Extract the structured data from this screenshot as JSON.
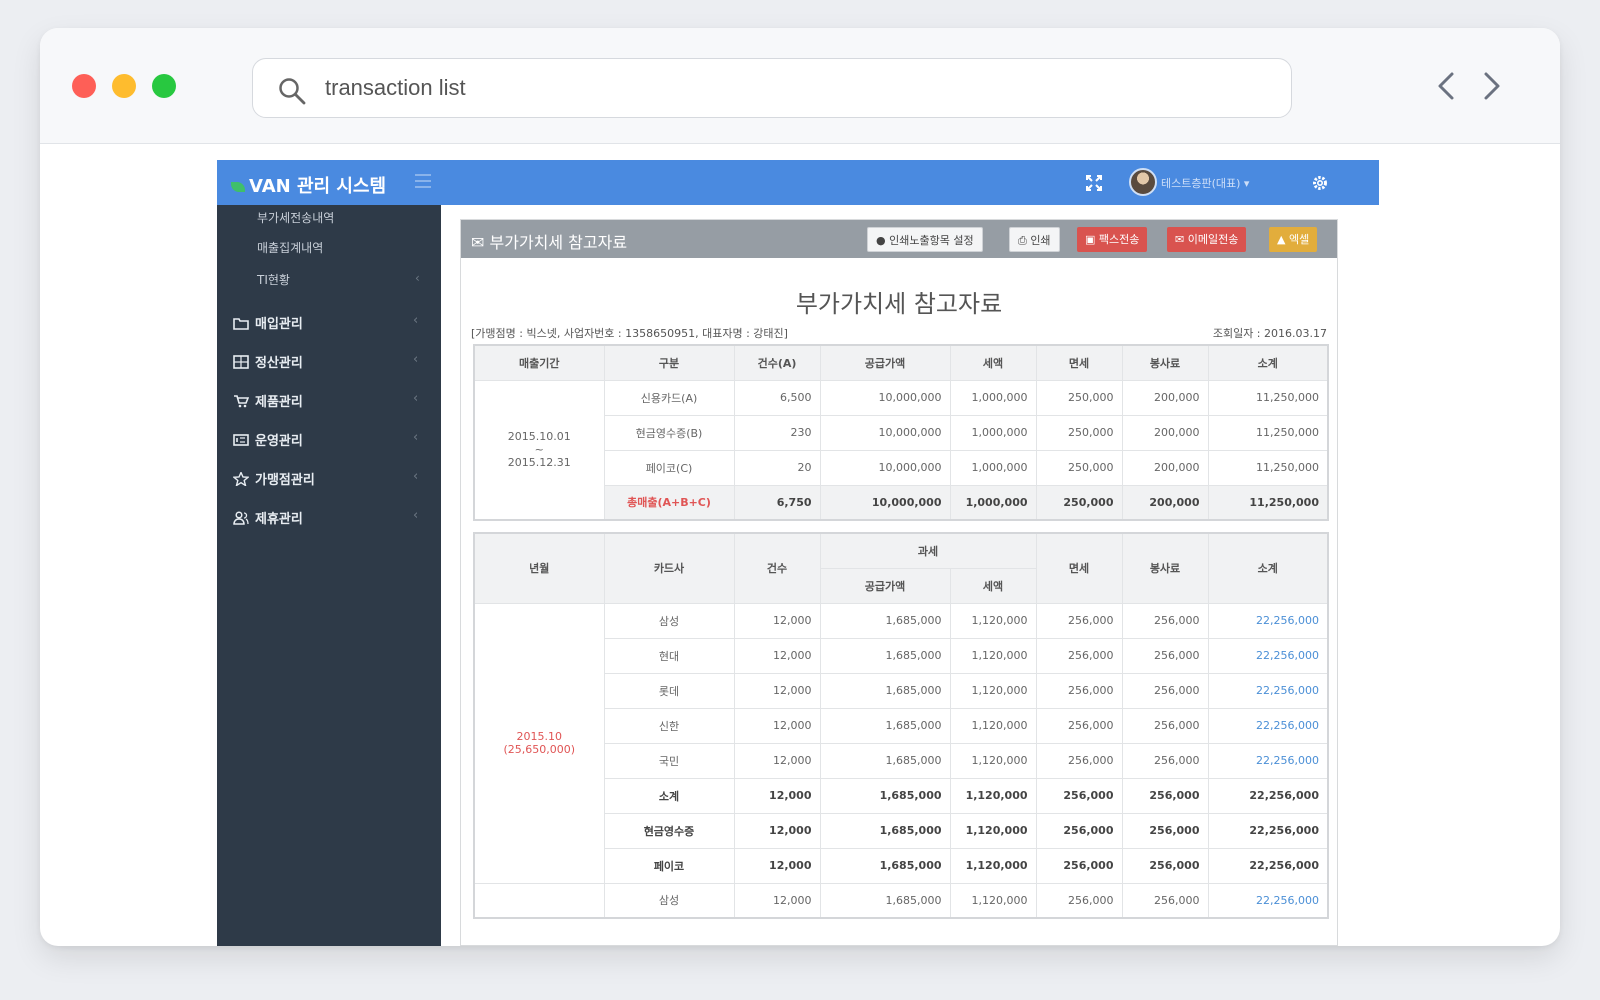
{
  "browser": {
    "search_query": "transaction list",
    "back_icon": "chevron-left-icon",
    "forward_icon": "chevron-right-icon"
  },
  "app": {
    "brand": "VAN 관리 시스템",
    "user_name": "테스트층판(대표)",
    "colors": {
      "topbar": "#4a8ae0",
      "sidebar": "#2e3a48",
      "danger": "#d9534f",
      "warning": "#e2ad3c"
    }
  },
  "sidebar": {
    "sub_items": [
      {
        "label": "부가세전송내역"
      },
      {
        "label": "매출집계내역"
      },
      {
        "label": "TI현황"
      }
    ],
    "menu_items": [
      {
        "label": "매입관리",
        "icon": "folder-icon"
      },
      {
        "label": "정산관리",
        "icon": "calculator-icon"
      },
      {
        "label": "제품관리",
        "icon": "cart-icon"
      },
      {
        "label": "운영관리",
        "icon": "card-icon"
      },
      {
        "label": "가맹점관리",
        "icon": "star-icon"
      },
      {
        "label": "제휴관리",
        "icon": "users-icon"
      }
    ]
  },
  "panel": {
    "header_title": "부가가치세 참고자료",
    "buttons": {
      "print_settings": "인쇄노출항목 설정",
      "print": "인쇄",
      "fax": "팩스전송",
      "email": "이메일전송",
      "excel": "엑셀"
    },
    "doc_title": "부가가치세 참고자료",
    "merchant_info": "[가맹점명 : 빅스넷, 사업자번호 : 1358650951, 대표자명 : 강태진]",
    "query_date": "조회일자 : 2016.03.17"
  },
  "summary_table": {
    "headers": [
      "매출기간",
      "구분",
      "건수(A)",
      "공급가액",
      "세액",
      "면세",
      "봉사료",
      "소계"
    ],
    "period_start": "2015.10.01",
    "period_sep": "~",
    "period_end": "2015.12.31",
    "rows": [
      [
        "신용카드(A)",
        "6,500",
        "10,000,000",
        "1,000,000",
        "250,000",
        "200,000",
        "11,250,000"
      ],
      [
        "현금영수증(B)",
        "230",
        "10,000,000",
        "1,000,000",
        "250,000",
        "200,000",
        "11,250,000"
      ],
      [
        "페이코(C)",
        "20",
        "10,000,000",
        "1,000,000",
        "250,000",
        "200,000",
        "11,250,000"
      ]
    ],
    "total_row": [
      "총매출(A+B+C)",
      "6,750",
      "10,000,000",
      "1,000,000",
      "250,000",
      "200,000",
      "11,250,000"
    ]
  },
  "detail_table": {
    "headers": {
      "month": "년월",
      "card": "카드사",
      "count": "건수",
      "taxable": "과세",
      "supply": "공급가액",
      "tax": "세액",
      "exempt": "면세",
      "service": "봉사료",
      "subtotal": "소계"
    },
    "month_label": "2015.10",
    "month_amount": "(25,650,000)",
    "rows": [
      {
        "cells": [
          "삼성",
          "12,000",
          "1,685,000",
          "1,120,000",
          "256,000",
          "256,000",
          "22,256,000"
        ],
        "bold": false
      },
      {
        "cells": [
          "현대",
          "12,000",
          "1,685,000",
          "1,120,000",
          "256,000",
          "256,000",
          "22,256,000"
        ],
        "bold": false
      },
      {
        "cells": [
          "롯데",
          "12,000",
          "1,685,000",
          "1,120,000",
          "256,000",
          "256,000",
          "22,256,000"
        ],
        "bold": false
      },
      {
        "cells": [
          "신한",
          "12,000",
          "1,685,000",
          "1,120,000",
          "256,000",
          "256,000",
          "22,256,000"
        ],
        "bold": false
      },
      {
        "cells": [
          "국민",
          "12,000",
          "1,685,000",
          "1,120,000",
          "256,000",
          "256,000",
          "22,256,000"
        ],
        "bold": false
      },
      {
        "cells": [
          "소계",
          "12,000",
          "1,685,000",
          "1,120,000",
          "256,000",
          "256,000",
          "22,256,000"
        ],
        "bold": true
      },
      {
        "cells": [
          "현금영수증",
          "12,000",
          "1,685,000",
          "1,120,000",
          "256,000",
          "256,000",
          "22,256,000"
        ],
        "bold": true
      },
      {
        "cells": [
          "페이코",
          "12,000",
          "1,685,000",
          "1,120,000",
          "256,000",
          "256,000",
          "22,256,000"
        ],
        "bold": true
      }
    ],
    "next_row": [
      "삼성",
      "12,000",
      "1,685,000",
      "1,120,000",
      "256,000",
      "256,000",
      "22,256,000"
    ]
  }
}
